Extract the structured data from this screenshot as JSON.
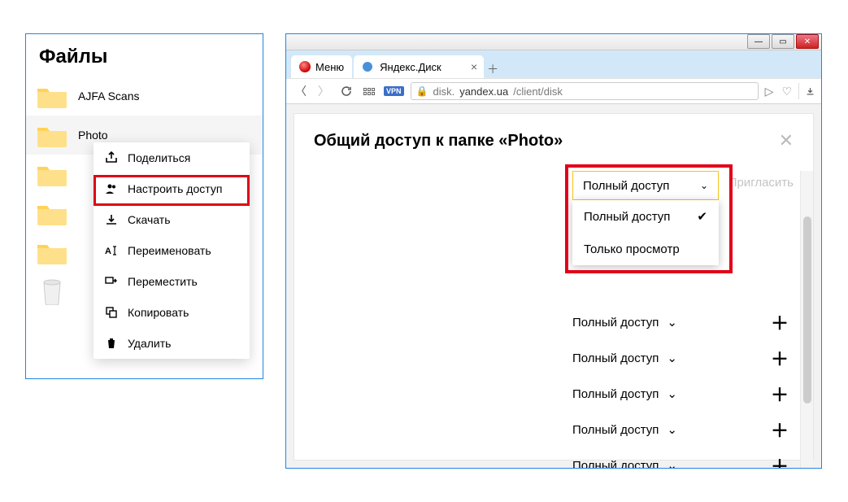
{
  "left": {
    "title": "Файлы",
    "folders": [
      "AJFA Scans",
      "Photo",
      "",
      "",
      ""
    ],
    "selected_index": 1
  },
  "context_menu": {
    "items": [
      {
        "label": "Поделиться"
      },
      {
        "label": "Настроить доступ"
      },
      {
        "label": "Скачать"
      },
      {
        "label": "Переименовать"
      },
      {
        "label": "Переместить"
      },
      {
        "label": "Копировать"
      },
      {
        "label": "Удалить"
      }
    ]
  },
  "browser": {
    "menu_label": "Меню",
    "tab_title": "Яндекс.Диск",
    "url_host": "disk.",
    "url_main": "yandex.ua",
    "url_path": "/client/disk"
  },
  "dialog": {
    "title": "Общий доступ к папке «Photo»",
    "invite_label": "Пригласить",
    "permission_selected": "Полный доступ",
    "dropdown": [
      "Полный доступ",
      "Только просмотр"
    ],
    "rows_label": "Полный доступ",
    "row_count": 5
  }
}
